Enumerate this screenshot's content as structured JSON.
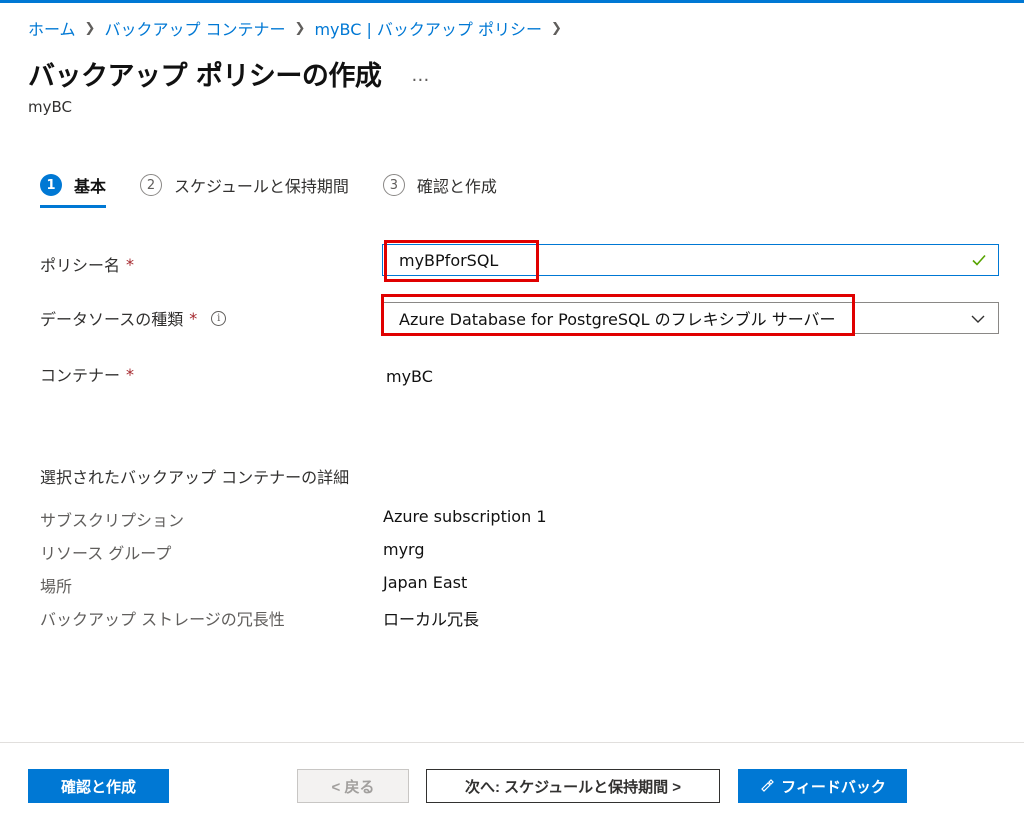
{
  "breadcrumb": [
    "ホーム",
    "バックアップ コンテナー",
    "myBC | バックアップ ポリシー"
  ],
  "page": {
    "title": "バックアップ ポリシーの作成",
    "more": "…",
    "subtitle": "myBC"
  },
  "steps": [
    {
      "num": "1",
      "label": "基本"
    },
    {
      "num": "2",
      "label": "スケジュールと保持期間"
    },
    {
      "num": "3",
      "label": "確認と作成"
    }
  ],
  "form": {
    "policy_name_label": "ポリシー名",
    "policy_name_value": "myBPforSQL",
    "datasource_label": "データソースの種類",
    "datasource_value": "Azure Database for PostgreSQL のフレキシブル サーバー",
    "container_label": "コンテナー",
    "container_value": "myBC",
    "required_mark": "*",
    "info": "i"
  },
  "details": {
    "title": "選択されたバックアップ コンテナーの詳細",
    "rows": [
      {
        "key": "サブスクリプション",
        "value": "Azure subscription 1"
      },
      {
        "key": "リソース グループ",
        "value": "myrg"
      },
      {
        "key": "場所",
        "value": "Japan East"
      },
      {
        "key": "バックアップ ストレージの冗長性",
        "value": "ローカル冗長"
      }
    ]
  },
  "footer": {
    "review_create": "確認と作成",
    "back": "< 戻る",
    "next": "次へ: スケジュールと保持期間 >",
    "feedback": "フィードバック"
  },
  "colors": {
    "accent": "#0078d4",
    "highlight": "#e00000",
    "required": "#a4262c",
    "valid_check": "#57a300"
  }
}
